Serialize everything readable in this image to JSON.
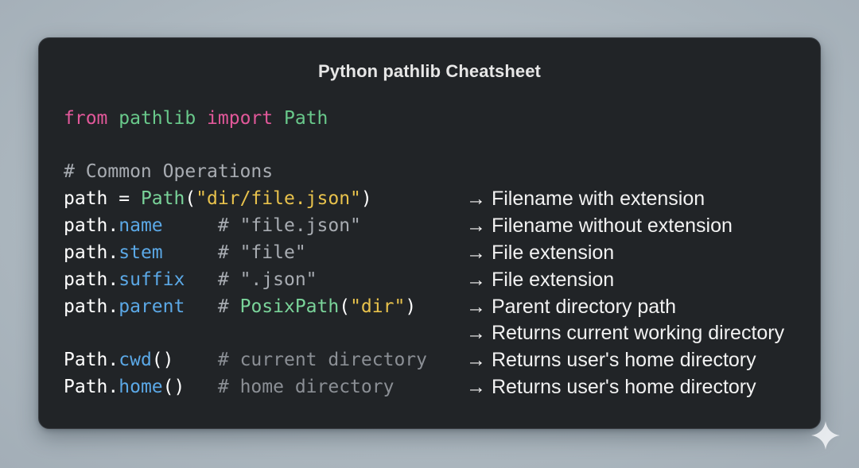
{
  "title": "Python pathlib Cheatsheet",
  "import_line": {
    "from": "from",
    "module": "pathlib",
    "import": "import",
    "name": "Path"
  },
  "section_comment": "# Common Operations",
  "code_lines": [
    {
      "obj": "path",
      "op": " = ",
      "call": "Path",
      "open": "(",
      "arg": "\"dir/file.json\"",
      "close": ")",
      "pad": "",
      "comment": ""
    },
    {
      "obj": "path.",
      "attr": "name",
      "pad": "     ",
      "comment": "# \"file.json\""
    },
    {
      "obj": "path.",
      "attr": "stem",
      "pad": "     ",
      "comment": "# \"file\""
    },
    {
      "obj": "path.",
      "attr": "suffix",
      "pad": "   ",
      "comment": "# \".json\""
    },
    {
      "obj": "path.",
      "attr": "parent",
      "pad": "   ",
      "comment_hash": "# ",
      "comment_call": "PosixPath",
      "comment_open": "(",
      "comment_arg": "\"dir\"",
      "comment_close": ")"
    },
    {
      "obj": "Path.",
      "attr": "cwd",
      "tail": "()",
      "pad": "    ",
      "comment": "# current directory"
    },
    {
      "obj": "Path.",
      "attr": "home",
      "tail": "()",
      "pad": "   ",
      "comment": "# home directory"
    }
  ],
  "notes": [
    "→ Filename with extension",
    "→ Filename without extension",
    "→ File extension",
    "→ File extension",
    "→ Parent directory path",
    "→ Returns current working directory",
    "→ Returns user's home directory",
    "→ Returns user's home directory"
  ],
  "colors": {
    "keyword": "#e2589a",
    "module": "#69c98b",
    "string": "#e8c24c",
    "attribute": "#5ba8e6",
    "comment": "#8b8f95",
    "card_background": "#212427"
  },
  "icons": {
    "corner": "sparkle-icon"
  }
}
